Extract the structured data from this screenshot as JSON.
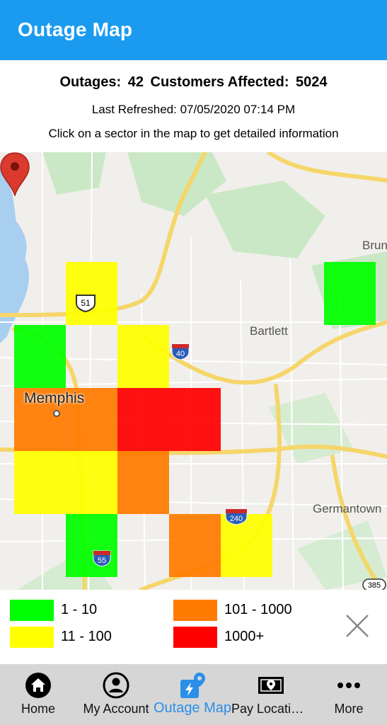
{
  "appbar": {
    "title": "Outage Map"
  },
  "summary": {
    "outages_label": "Outages:",
    "outages_value": "42",
    "customers_label": "Customers Affected:",
    "customers_value": "5024",
    "last_refreshed": "Last Refreshed: 07/05/2020 07:14 PM",
    "hint": "Click on a sector in the map to get detailed information"
  },
  "map": {
    "labels": {
      "memphis": "Memphis",
      "bartlett": "Bartlett",
      "germantown": "Germantown",
      "brunswick": "Brun",
      "us51": "51",
      "i40": "40",
      "i240": "240",
      "i55": "55",
      "r385": "385"
    },
    "sectors": [
      {
        "col": 1,
        "row": 0,
        "level": "11 - 100"
      },
      {
        "col": 6,
        "row": 0,
        "level": "1 - 10"
      },
      {
        "col": 0,
        "row": 1,
        "level": "1 - 10"
      },
      {
        "col": 2,
        "row": 1,
        "level": "11 - 100"
      },
      {
        "col": 0,
        "row": 2,
        "level": "101 - 1000"
      },
      {
        "col": 1,
        "row": 2,
        "level": "101 - 1000"
      },
      {
        "col": 2,
        "row": 2,
        "level": "1000+"
      },
      {
        "col": 3,
        "row": 2,
        "level": "1000+"
      },
      {
        "col": 0,
        "row": 3,
        "level": "11 - 100"
      },
      {
        "col": 1,
        "row": 3,
        "level": "11 - 100"
      },
      {
        "col": 2,
        "row": 3,
        "level": "101 - 1000"
      },
      {
        "col": 1,
        "row": 4,
        "level": "1 - 10"
      },
      {
        "col": 3,
        "row": 4,
        "level": "101 - 1000"
      },
      {
        "col": 4,
        "row": 4,
        "level": "11 - 100"
      }
    ]
  },
  "legend": {
    "items": [
      {
        "label": "1 - 10",
        "color": "#00ff00"
      },
      {
        "label": "11 - 100",
        "color": "#ffff00"
      },
      {
        "label": "101 - 1000",
        "color": "#ff7b00"
      },
      {
        "label": "1000+",
        "color": "#ff0000"
      }
    ]
  },
  "tabs": [
    {
      "label": "Home",
      "icon": "home-icon",
      "active": false
    },
    {
      "label": "My Account",
      "icon": "account-icon",
      "active": false
    },
    {
      "label": "Outage Map",
      "icon": "outage-map-icon",
      "active": true
    },
    {
      "label": "Pay Locations",
      "icon": "pay-locations-icon",
      "active": false
    },
    {
      "label": "More",
      "icon": "more-icon",
      "active": false
    }
  ],
  "colors": {
    "appbar": "#1a9bf0",
    "tab_active": "#2b8fe8",
    "pin": "#db3a2e"
  }
}
